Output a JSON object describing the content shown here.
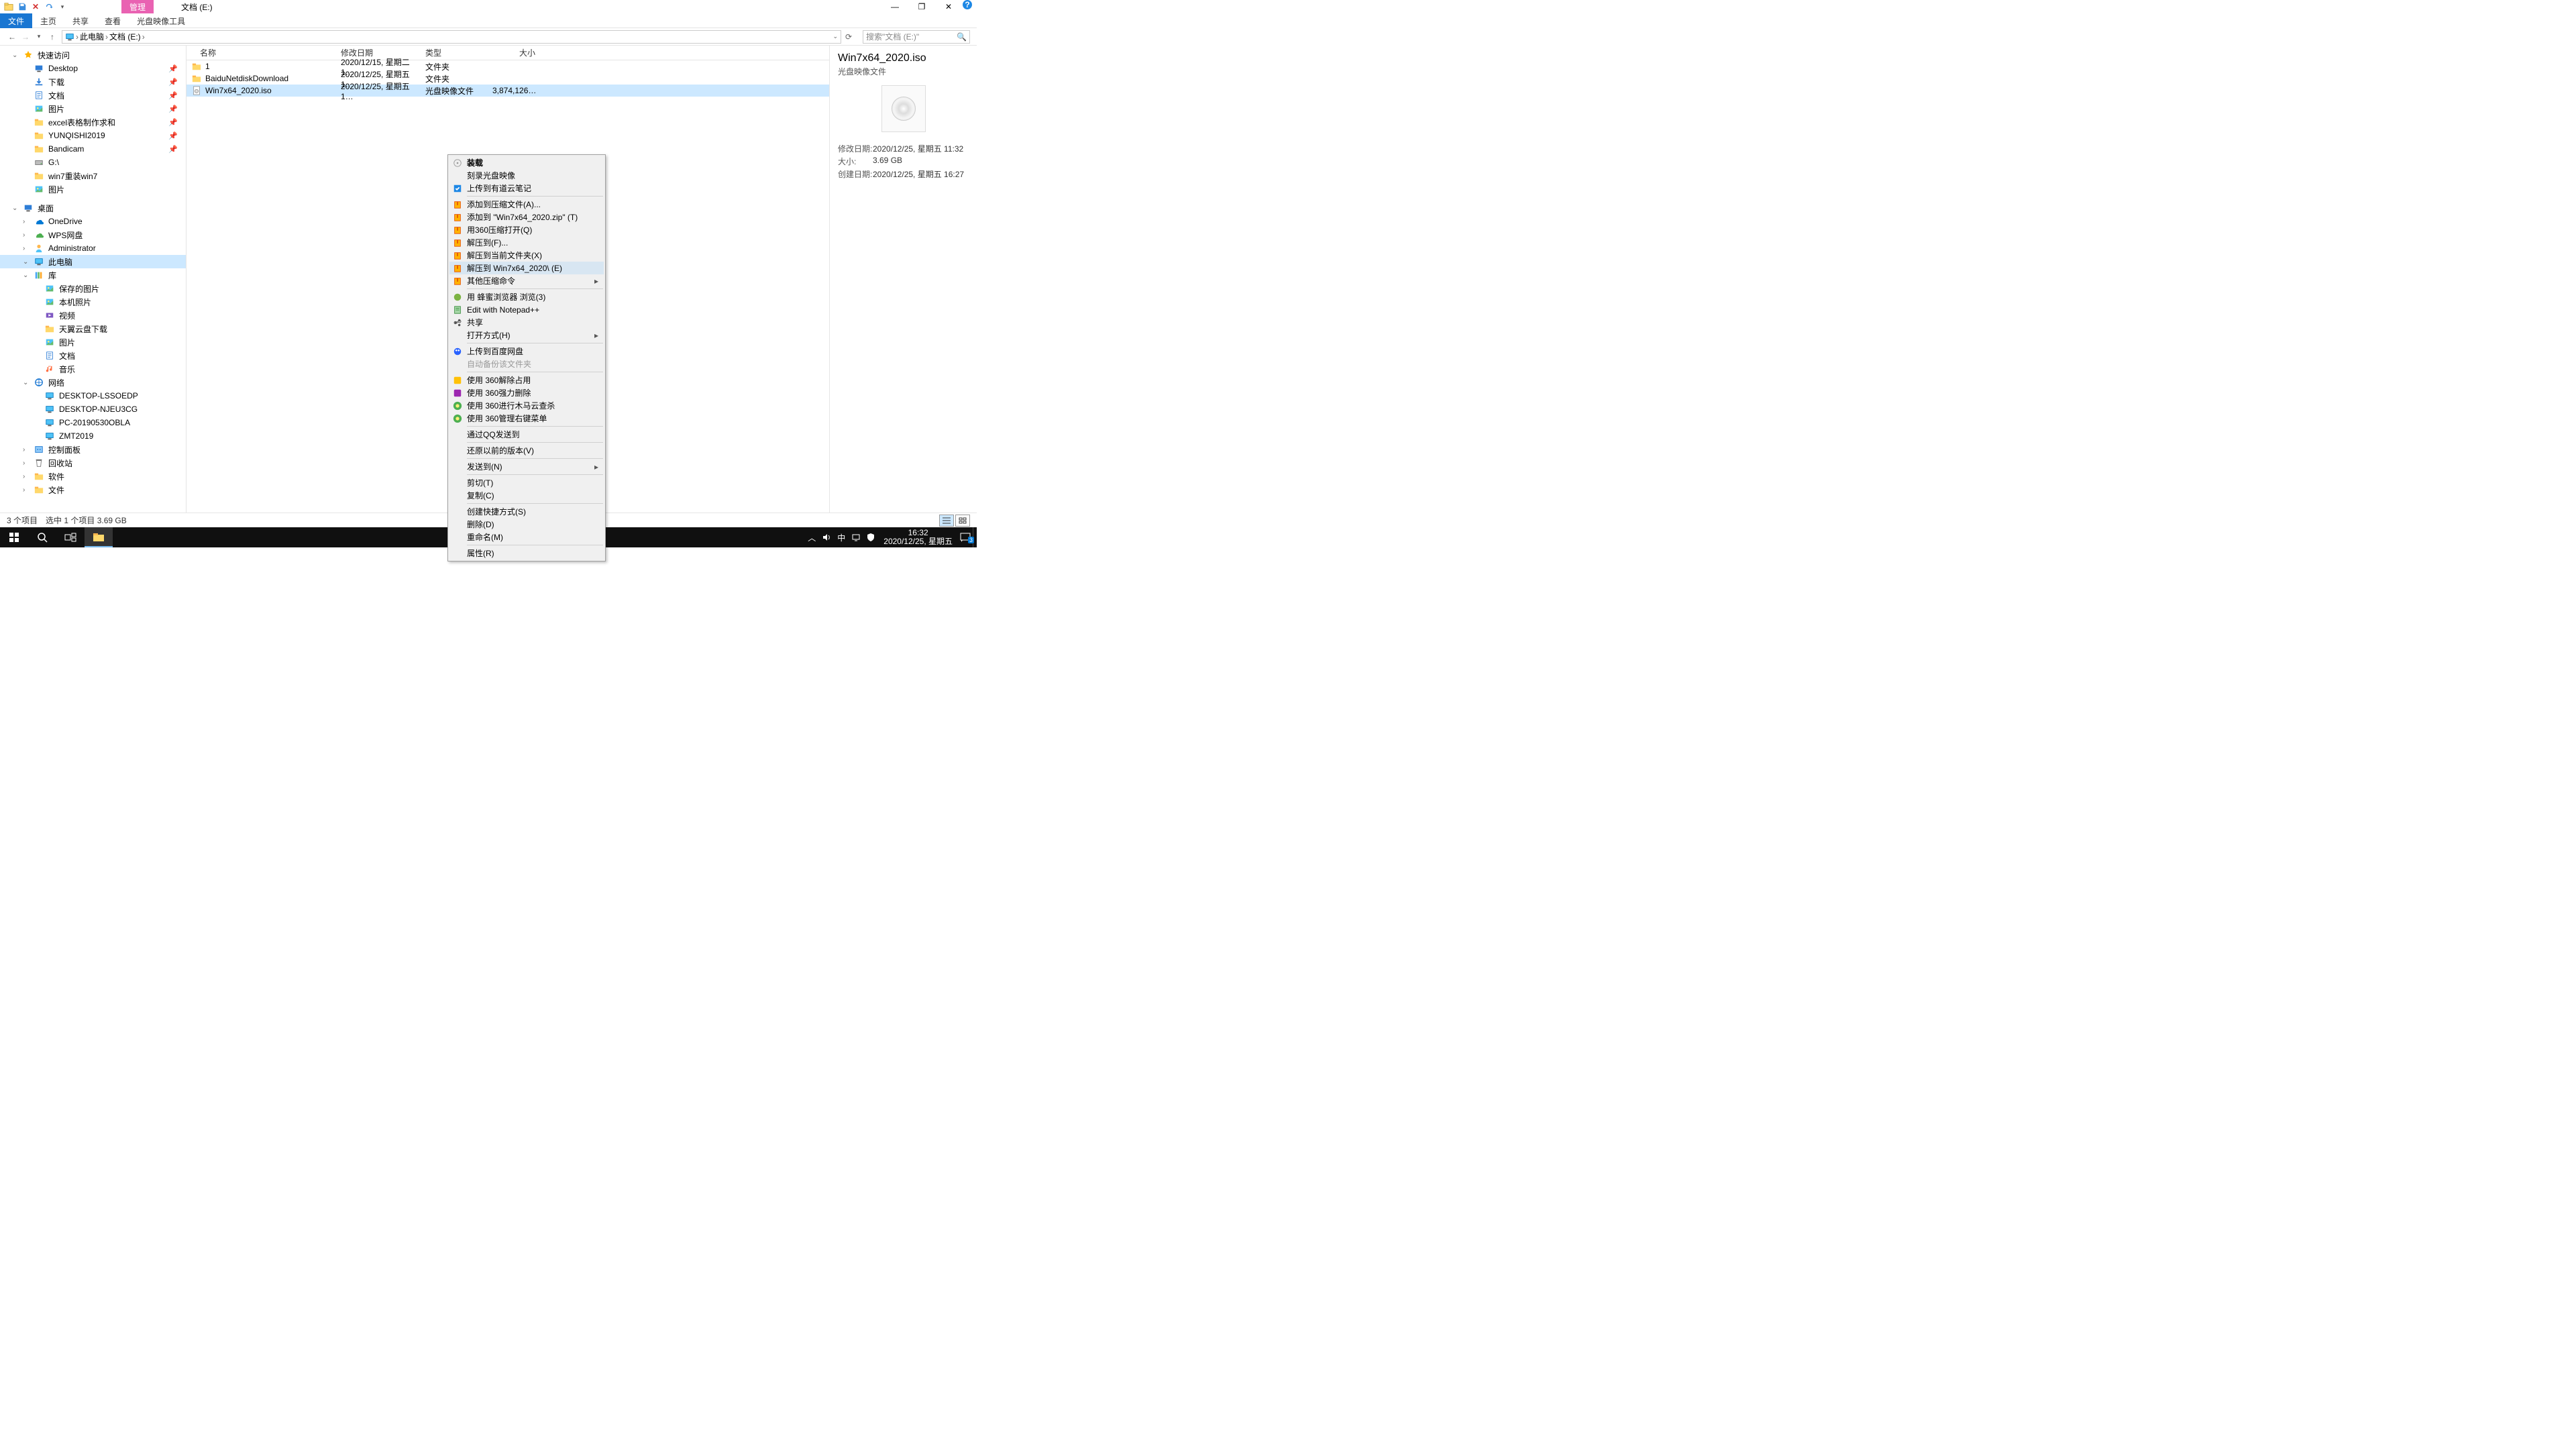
{
  "title": {
    "manage": "管理",
    "location": "文档 (E:)"
  },
  "wincontrols": {
    "min": "—",
    "max": "❐",
    "close": "✕",
    "help": "?"
  },
  "ribbon": {
    "file": "文件",
    "home": "主页",
    "share": "共享",
    "view": "查看",
    "isotools": "光盘映像工具"
  },
  "nav": {
    "back": "←",
    "fwd": "→",
    "up": "↑",
    "refresh": "⟳"
  },
  "crumbs": {
    "pc": "此电脑",
    "drive": "文档 (E:)",
    "sep": "›"
  },
  "search": {
    "placeholder": "搜索\"文档 (E:)\""
  },
  "tree": {
    "quick": "快速访问",
    "quick_items": [
      "Desktop",
      "下载",
      "文档",
      "图片",
      "excel表格制作求和",
      "YUNQISHI2019",
      "Bandicam",
      "G:\\",
      "win7重装win7",
      "图片"
    ],
    "desktop": "桌面",
    "desktop_items": [
      "OneDrive",
      "WPS网盘",
      "Administrator",
      "此电脑",
      "库",
      "保存的图片",
      "本机照片",
      "视频",
      "天翼云盘下载",
      "图片",
      "文档",
      "音乐",
      "网络",
      "DESKTOP-LSSOEDP",
      "DESKTOP-NJEU3CG",
      "PC-20190530OBLA",
      "ZMT2019",
      "控制面板",
      "回收站",
      "软件",
      "文件"
    ]
  },
  "cols": {
    "name": "名称",
    "mod": "修改日期",
    "type": "类型",
    "size": "大小"
  },
  "rows": [
    {
      "name": "1",
      "mod": "2020/12/15, 星期二 1…",
      "type": "文件夹",
      "size": "",
      "icon": "folder"
    },
    {
      "name": "BaiduNetdiskDownload",
      "mod": "2020/12/25, 星期五 1…",
      "type": "文件夹",
      "size": "",
      "icon": "folder"
    },
    {
      "name": "Win7x64_2020.iso",
      "mod": "2020/12/25, 星期五 1…",
      "type": "光盘映像文件",
      "size": "3,874,126…",
      "icon": "iso"
    }
  ],
  "details": {
    "name": "Win7x64_2020.iso",
    "type": "光盘映像文件",
    "kv": [
      {
        "k": "修改日期:",
        "v": "2020/12/25, 星期五 11:32"
      },
      {
        "k": "大小:",
        "v": "3.69 GB"
      },
      {
        "k": "创建日期:",
        "v": "2020/12/25, 星期五 16:27"
      }
    ]
  },
  "status": {
    "count": "3 个项目",
    "sel": "选中 1 个项目  3.69 GB"
  },
  "ctx": [
    {
      "t": "装载",
      "b": true,
      "i": "disc"
    },
    {
      "t": "刻录光盘映像"
    },
    {
      "t": "上传到有道云笔记",
      "i": "blue"
    },
    {
      "sep": true
    },
    {
      "t": "添加到压缩文件(A)...",
      "i": "zip"
    },
    {
      "t": "添加到 \"Win7x64_2020.zip\" (T)",
      "i": "zip"
    },
    {
      "t": "用360压缩打开(Q)",
      "i": "zip"
    },
    {
      "t": "解压到(F)...",
      "i": "zip"
    },
    {
      "t": "解压到当前文件夹(X)",
      "i": "zip"
    },
    {
      "t": "解压到 Win7x64_2020\\ (E)",
      "i": "zip",
      "hover": true
    },
    {
      "t": "其他压缩命令",
      "i": "zip",
      "sub": true
    },
    {
      "sep": true
    },
    {
      "t": "用 蜂蜜浏览器 浏览(3)",
      "i": "green"
    },
    {
      "t": "Edit with Notepad++",
      "i": "npp"
    },
    {
      "t": "共享",
      "i": "share"
    },
    {
      "t": "打开方式(H)",
      "sub": true
    },
    {
      "sep": true
    },
    {
      "t": "上传到百度网盘",
      "i": "baidu"
    },
    {
      "t": "自动备份该文件夹",
      "disabled": true
    },
    {
      "sep": true
    },
    {
      "t": "使用 360解除占用",
      "i": "y360"
    },
    {
      "t": "使用 360强力删除",
      "i": "p360"
    },
    {
      "t": "使用 360进行木马云查杀",
      "i": "g360"
    },
    {
      "t": "使用 360管理右键菜单",
      "i": "g360"
    },
    {
      "sep": true
    },
    {
      "t": "通过QQ发送到"
    },
    {
      "sep": true
    },
    {
      "t": "还原以前的版本(V)"
    },
    {
      "sep": true
    },
    {
      "t": "发送到(N)",
      "sub": true
    },
    {
      "sep": true
    },
    {
      "t": "剪切(T)"
    },
    {
      "t": "复制(C)"
    },
    {
      "sep": true
    },
    {
      "t": "创建快捷方式(S)"
    },
    {
      "t": "删除(D)"
    },
    {
      "t": "重命名(M)"
    },
    {
      "sep": true
    },
    {
      "t": "属性(R)"
    }
  ],
  "taskbar": {
    "time": "16:32",
    "date": "2020/12/25, 星期五",
    "ime": "中",
    "notif": "3"
  }
}
